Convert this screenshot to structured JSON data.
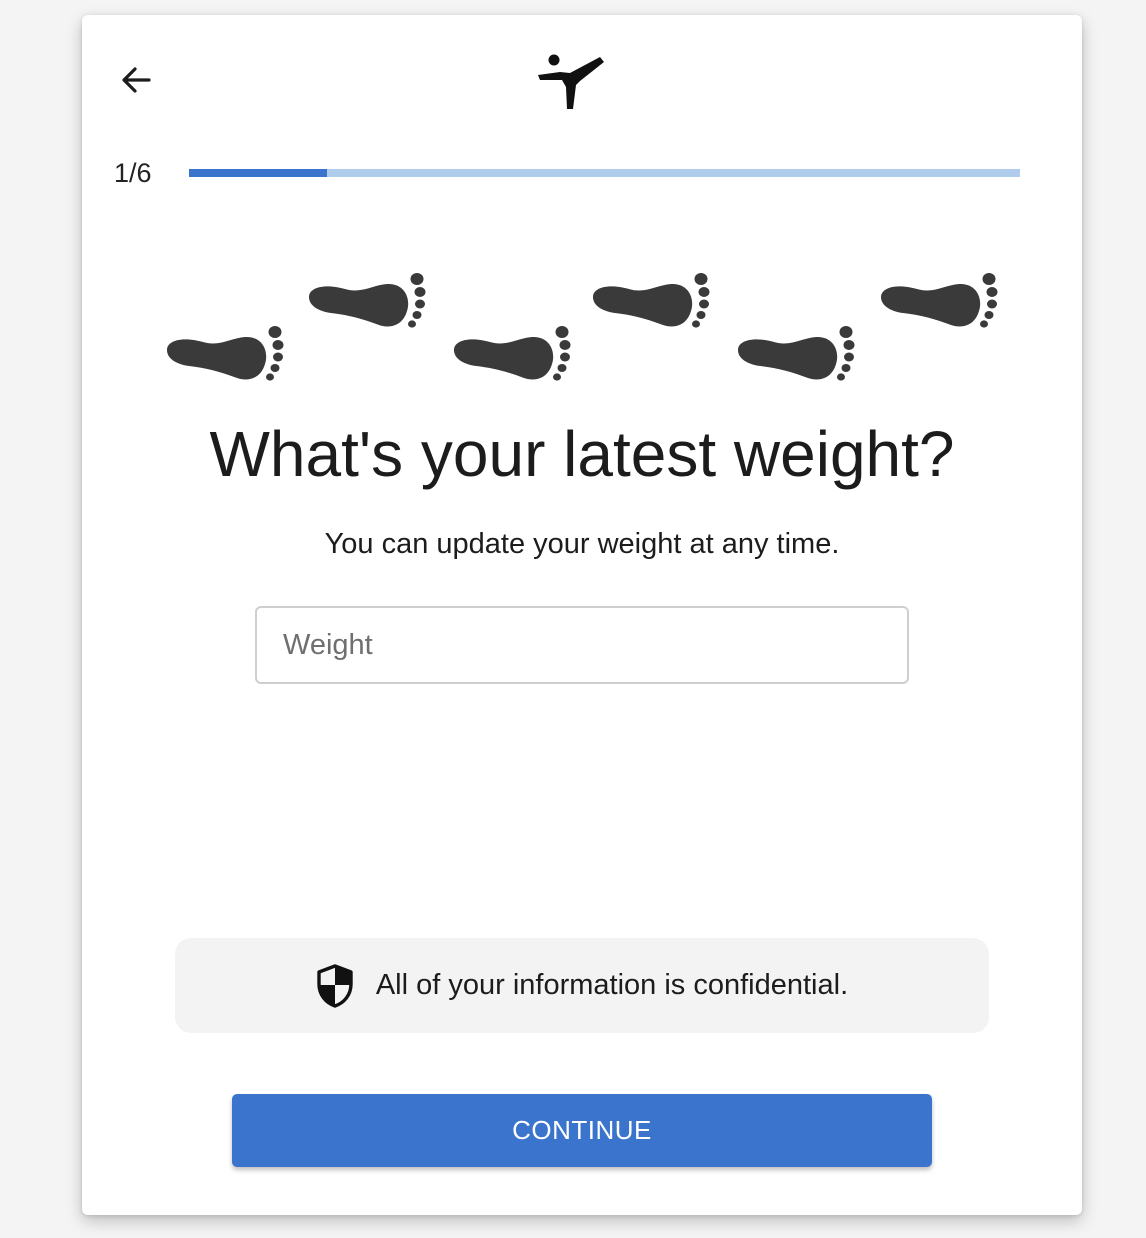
{
  "header": {
    "back_icon": "arrow-left-icon",
    "logo_icon": "martial-arts-kick-logo"
  },
  "progress": {
    "label": "1/6",
    "current_step": 1,
    "total_steps": 6,
    "fill_color": "#3a74cc",
    "track_color": "#b0ccec"
  },
  "illustration": {
    "icon": "footprints-icon"
  },
  "main": {
    "title": "What's your latest weight?",
    "subtitle": "You can update your weight at any time.",
    "weight_field": {
      "placeholder": "Weight",
      "value": ""
    }
  },
  "notice": {
    "icon": "shield-icon",
    "text": "All of your information is confidential."
  },
  "actions": {
    "continue_label": "CONTINUE",
    "accent_color": "#3a74cc"
  }
}
